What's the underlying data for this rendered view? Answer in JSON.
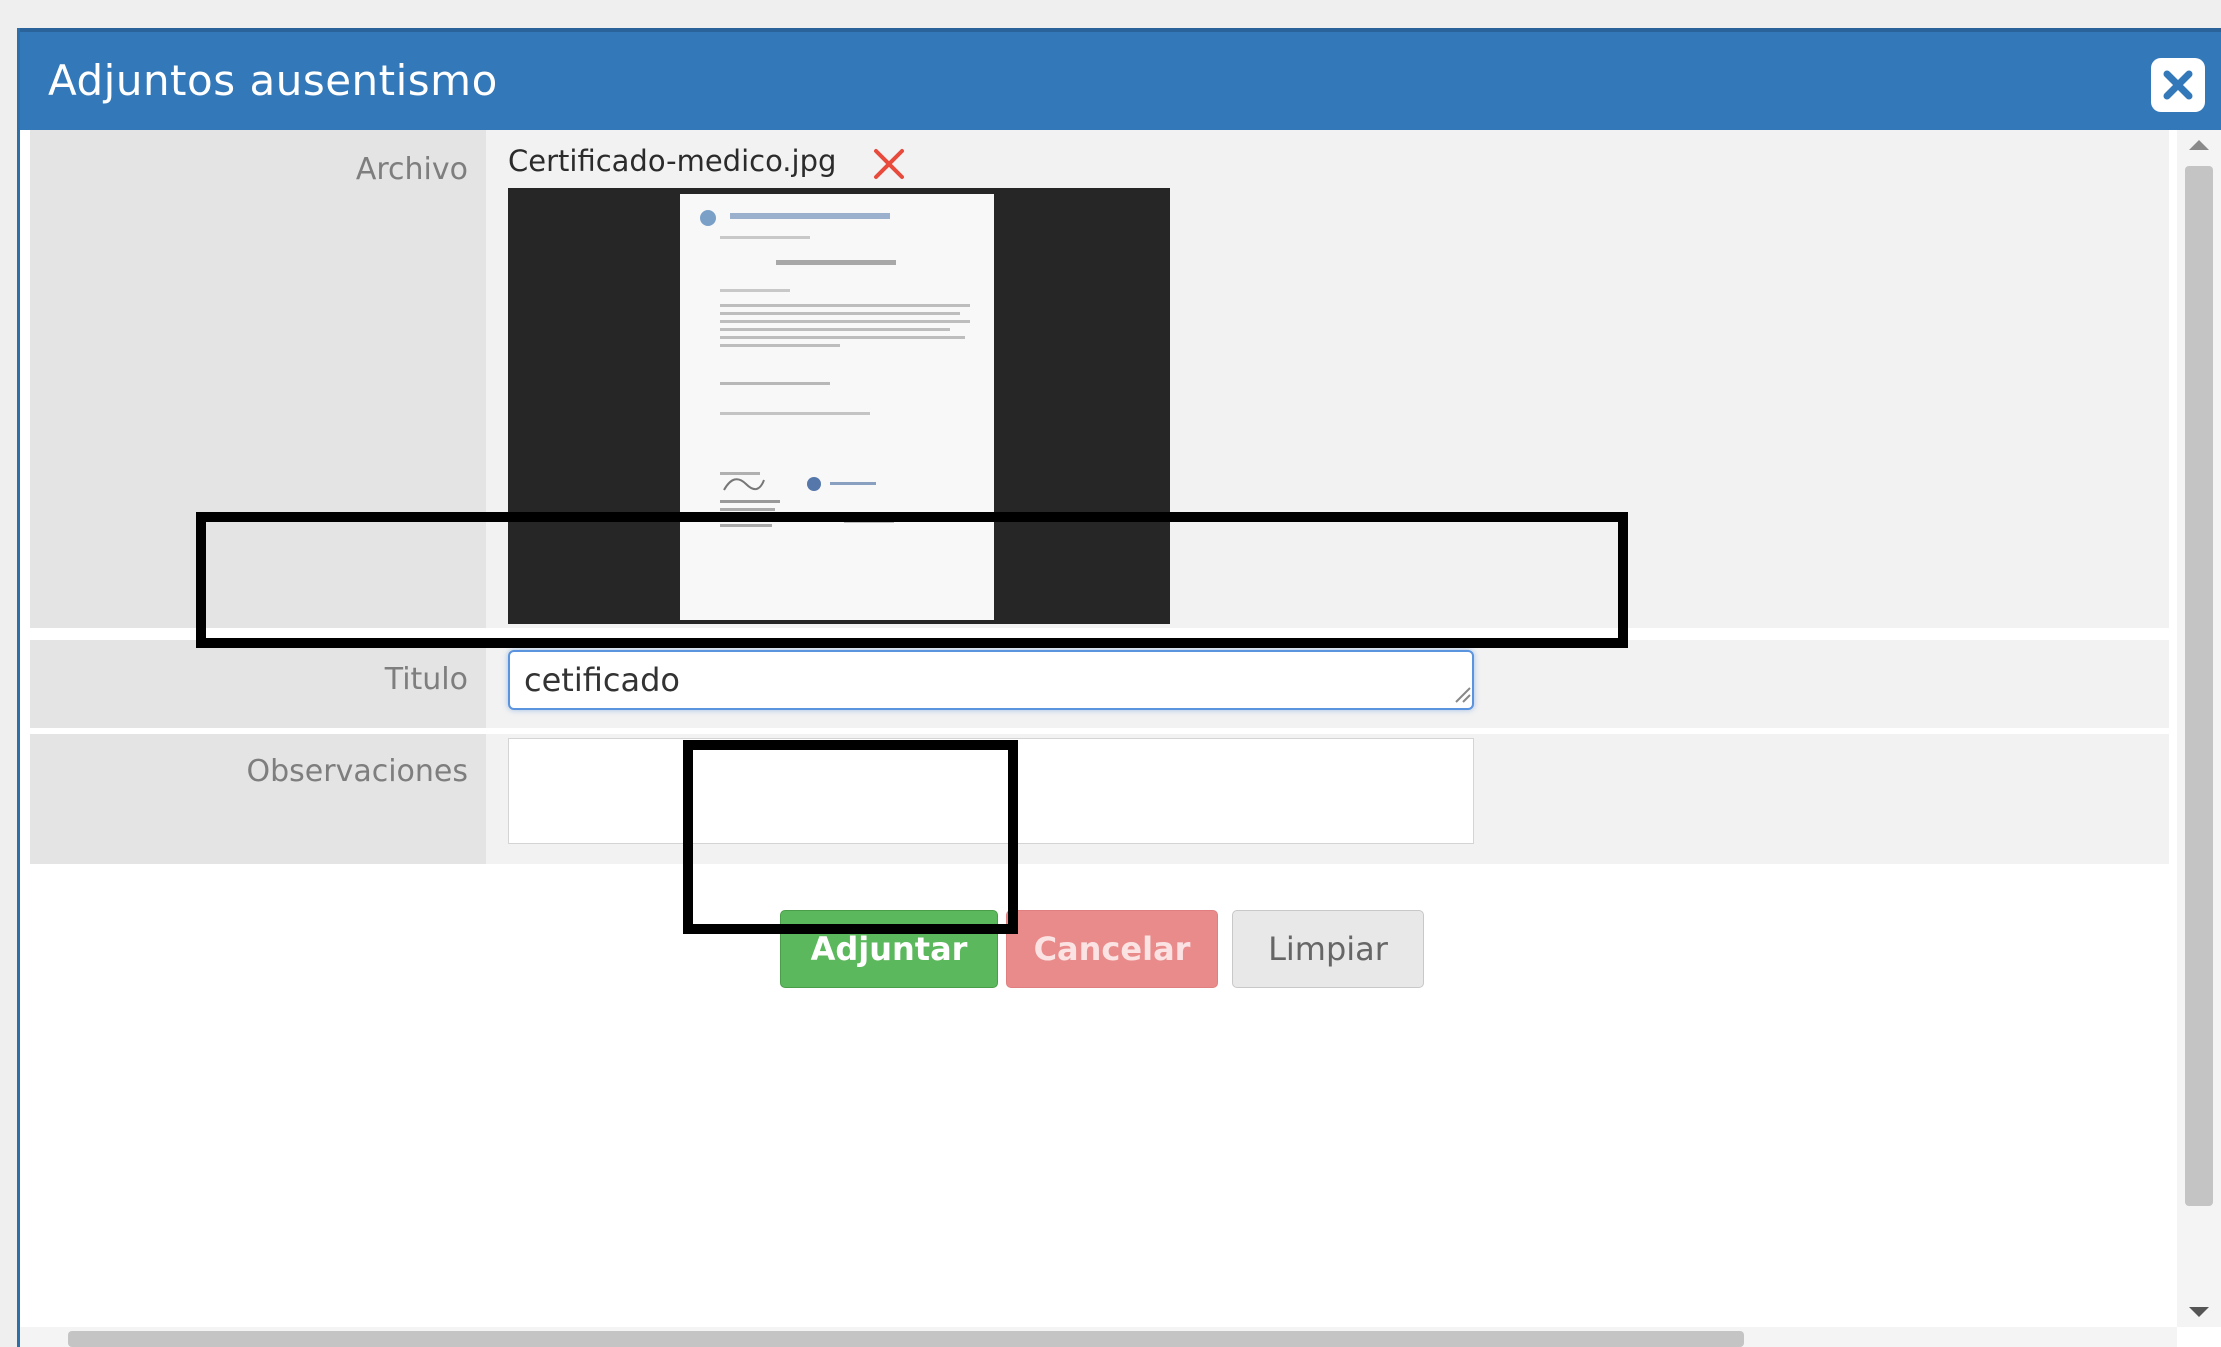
{
  "dialog": {
    "title": "Adjuntos ausentismo",
    "close_icon": "close-icon"
  },
  "form": {
    "archivo": {
      "label": "Archivo",
      "filename": "Certificado-medico.jpg",
      "remove_icon": "x-icon"
    },
    "titulo": {
      "label": "Titulo",
      "value": "cetificado"
    },
    "observaciones": {
      "label": "Observaciones",
      "value": ""
    }
  },
  "buttons": {
    "attach": "Adjuntar",
    "cancel": "Cancelar",
    "clear": "Limpiar"
  },
  "colors": {
    "titlebar": "#3378b9",
    "attach": "#5cb85c",
    "cancel": "#ea8b8b",
    "remove": "#e84a3c"
  }
}
